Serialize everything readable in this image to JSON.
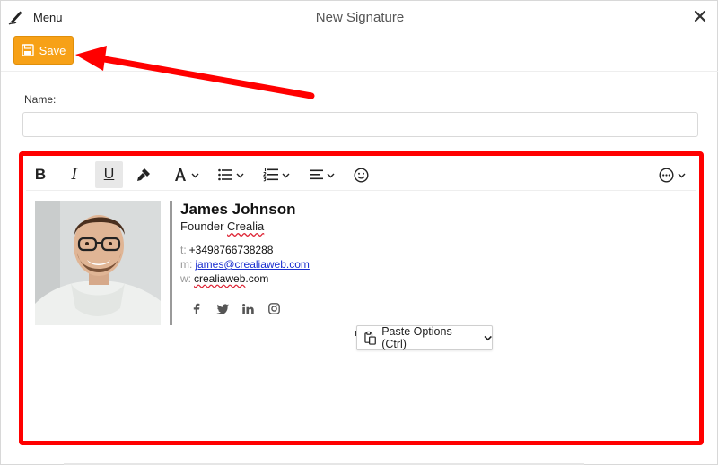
{
  "window": {
    "title": "New Signature",
    "menu_label": "Menu"
  },
  "toolbar": {
    "save_label": "Save"
  },
  "form": {
    "name_label": "Name:",
    "name_value": "",
    "name_placeholder": ""
  },
  "editor_toolbar": {
    "bold_label": "B",
    "italic_label": "I",
    "underline_label": "U",
    "buttons": [
      "bold",
      "italic",
      "underline",
      "format-painter-icon",
      "font-color-icon",
      "bullet-list-icon",
      "numbered-list-icon",
      "align-icon",
      "emoji-icon",
      "more-options-icon"
    ]
  },
  "signature": {
    "name": "James Johnson",
    "role": "Founder",
    "company": "Crealia",
    "phone_label": "t:",
    "phone": "+3498766738288",
    "email_label": "m:",
    "email": "james@crealiaweb.com",
    "web_label": "w:",
    "web_domain": "crealiaweb",
    "web_tld": ".com",
    "social": [
      "facebook-icon",
      "twitter-icon",
      "linkedin-icon",
      "instagram-icon"
    ]
  },
  "paste_options": {
    "label": "Paste Options (Ctrl)"
  },
  "colors": {
    "accent": "#f7a117",
    "annotation": "#ff0000",
    "link": "#1a2ecf"
  }
}
